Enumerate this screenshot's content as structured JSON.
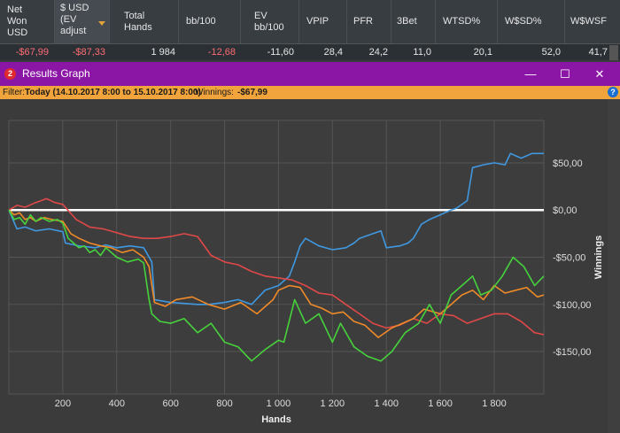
{
  "stats": {
    "columns": [
      {
        "label": "Net\nWon\nUSD",
        "value": "-$67,99",
        "negative": true
      },
      {
        "label": "$ USD\n(EV\nadjust",
        "value": "-$87,33",
        "negative": true,
        "sorted": true
      },
      {
        "label": "Total\nHands",
        "value": "1 984",
        "negative": false
      },
      {
        "label": "bb/100",
        "value": "-12,68",
        "negative": true
      },
      {
        "label": "EV\nbb/100",
        "value": "-11,60",
        "negative": false
      },
      {
        "label": "VPIP",
        "value": "28,4",
        "negative": false
      },
      {
        "label": "PFR",
        "value": "24,2",
        "negative": false
      },
      {
        "label": "3Bet",
        "value": "11,0",
        "negative": false
      },
      {
        "label": "WTSD%",
        "value": "20,1",
        "negative": false
      },
      {
        "label": "W$SD%",
        "value": "52,0",
        "negative": false
      },
      {
        "label": "W$WSF",
        "value": "41,7",
        "negative": false
      }
    ]
  },
  "window": {
    "icon_text": "2",
    "title": "Results Graph",
    "minimize": "—",
    "maximize": "☐",
    "close": "✕"
  },
  "filter": {
    "label": "Filter:",
    "range": "Today (14.10.2017 8:00 to 15.10.2017 8:00)",
    "winnings_label": "Winnings:",
    "winnings_value": "-$67,99",
    "help": "?"
  },
  "colors": {
    "titlebar": "#8b16a6",
    "filterbar": "#f1a43b",
    "net_won": "#46d23c",
    "ev_adjusted": "#f08a28",
    "non_showdown": "#e04848",
    "showdown": "#3f98e0",
    "zero_line": "#ffffff",
    "grid": "#555555"
  },
  "chart_data": {
    "type": "line",
    "xlabel": "Hands",
    "ylabel": "Winnings",
    "xlim": [
      0,
      1984
    ],
    "ylim": [
      -195,
      95
    ],
    "x_ticks": [
      200,
      400,
      600,
      800,
      1000,
      1200,
      1400,
      1600,
      1800
    ],
    "x_tick_labels": [
      "200",
      "400",
      "600",
      "800",
      "1 000",
      "1 200",
      "1 400",
      "1 600",
      "1 800"
    ],
    "y_ticks": [
      50,
      0,
      -50,
      -100,
      -150
    ],
    "y_tick_labels": [
      "$50,00",
      "$0,00",
      "-$50,00",
      "-$100,00",
      "-$150,00"
    ],
    "grid": true,
    "series": [
      {
        "key": "net_won",
        "x": [
          0,
          20,
          40,
          60,
          80,
          100,
          120,
          150,
          180,
          200,
          220,
          240,
          260,
          280,
          300,
          320,
          340,
          360,
          400,
          440,
          480,
          500,
          520,
          530,
          560,
          600,
          650,
          700,
          750,
          800,
          850,
          900,
          950,
          1000,
          1020,
          1060,
          1100,
          1150,
          1200,
          1230,
          1280,
          1330,
          1380,
          1420,
          1470,
          1520,
          1560,
          1600,
          1640,
          1680,
          1720,
          1750,
          1790,
          1830,
          1870,
          1910,
          1950,
          1984
        ],
        "y": [
          0,
          -10,
          -8,
          -15,
          -5,
          -12,
          -8,
          -12,
          -10,
          -14,
          -30,
          -35,
          -40,
          -38,
          -45,
          -42,
          -48,
          -40,
          -50,
          -55,
          -52,
          -56,
          -95,
          -110,
          -118,
          -120,
          -115,
          -130,
          -120,
          -140,
          -145,
          -160,
          -148,
          -138,
          -140,
          -95,
          -120,
          -110,
          -140,
          -120,
          -145,
          -155,
          -160,
          -150,
          -130,
          -120,
          -100,
          -120,
          -90,
          -80,
          -70,
          -90,
          -85,
          -70,
          -50,
          -60,
          -80,
          -70
        ]
      },
      {
        "key": "ev_adjusted",
        "x": [
          0,
          20,
          40,
          60,
          80,
          100,
          130,
          160,
          200,
          230,
          260,
          300,
          340,
          380,
          420,
          460,
          500,
          520,
          540,
          580,
          620,
          680,
          740,
          800,
          860,
          920,
          980,
          1000,
          1040,
          1080,
          1120,
          1160,
          1200,
          1240,
          1280,
          1320,
          1370,
          1420,
          1460,
          1500,
          1540,
          1600,
          1640,
          1680,
          1720,
          1760,
          1800,
          1840,
          1880,
          1920,
          1960,
          1984
        ],
        "y": [
          0,
          -5,
          -3,
          -10,
          -8,
          -12,
          -8,
          -10,
          -12,
          -25,
          -30,
          -35,
          -38,
          -40,
          -45,
          -42,
          -50,
          -60,
          -98,
          -102,
          -95,
          -92,
          -100,
          -105,
          -98,
          -110,
          -95,
          -85,
          -80,
          -82,
          -100,
          -104,
          -110,
          -108,
          -118,
          -122,
          -135,
          -125,
          -120,
          -115,
          -105,
          -110,
          -100,
          -90,
          -85,
          -95,
          -80,
          -88,
          -85,
          -82,
          -92,
          -90
        ]
      },
      {
        "key": "non_showdown",
        "x": [
          0,
          30,
          60,
          100,
          140,
          170,
          200,
          250,
          300,
          350,
          400,
          450,
          500,
          550,
          600,
          650,
          700,
          750,
          800,
          850,
          900,
          950,
          1000,
          1050,
          1100,
          1150,
          1200,
          1250,
          1300,
          1350,
          1400,
          1450,
          1500,
          1550,
          1600,
          1650,
          1700,
          1750,
          1800,
          1850,
          1900,
          1950,
          1984
        ],
        "y": [
          0,
          5,
          3,
          8,
          12,
          8,
          6,
          -10,
          -18,
          -20,
          -24,
          -28,
          -30,
          -30,
          -28,
          -25,
          -28,
          -48,
          -55,
          -58,
          -65,
          -70,
          -72,
          -74,
          -80,
          -88,
          -90,
          -100,
          -110,
          -120,
          -125,
          -122,
          -115,
          -120,
          -110,
          -112,
          -120,
          -115,
          -110,
          -110,
          -118,
          -130,
          -132
        ]
      },
      {
        "key": "showdown",
        "x": [
          0,
          30,
          60,
          100,
          150,
          200,
          210,
          260,
          320,
          360,
          400,
          450,
          500,
          530,
          540,
          600,
          700,
          740,
          800,
          850,
          900,
          950,
          1000,
          1040,
          1060,
          1080,
          1100,
          1150,
          1200,
          1250,
          1280,
          1300,
          1350,
          1380,
          1400,
          1450,
          1480,
          1500,
          1530,
          1560,
          1600,
          1640,
          1660,
          1700,
          1720,
          1760,
          1800,
          1840,
          1860,
          1900,
          1940,
          1984
        ],
        "y": [
          0,
          -20,
          -18,
          -22,
          -20,
          -23,
          -35,
          -38,
          -40,
          -37,
          -40,
          -38,
          -40,
          -55,
          -95,
          -98,
          -100,
          -100,
          -98,
          -95,
          -100,
          -85,
          -80,
          -70,
          -55,
          -38,
          -30,
          -38,
          -42,
          -40,
          -35,
          -30,
          -25,
          -22,
          -40,
          -38,
          -35,
          -30,
          -15,
          -10,
          -5,
          0,
          2,
          10,
          45,
          48,
          50,
          48,
          60,
          55,
          60,
          60
        ]
      }
    ]
  }
}
